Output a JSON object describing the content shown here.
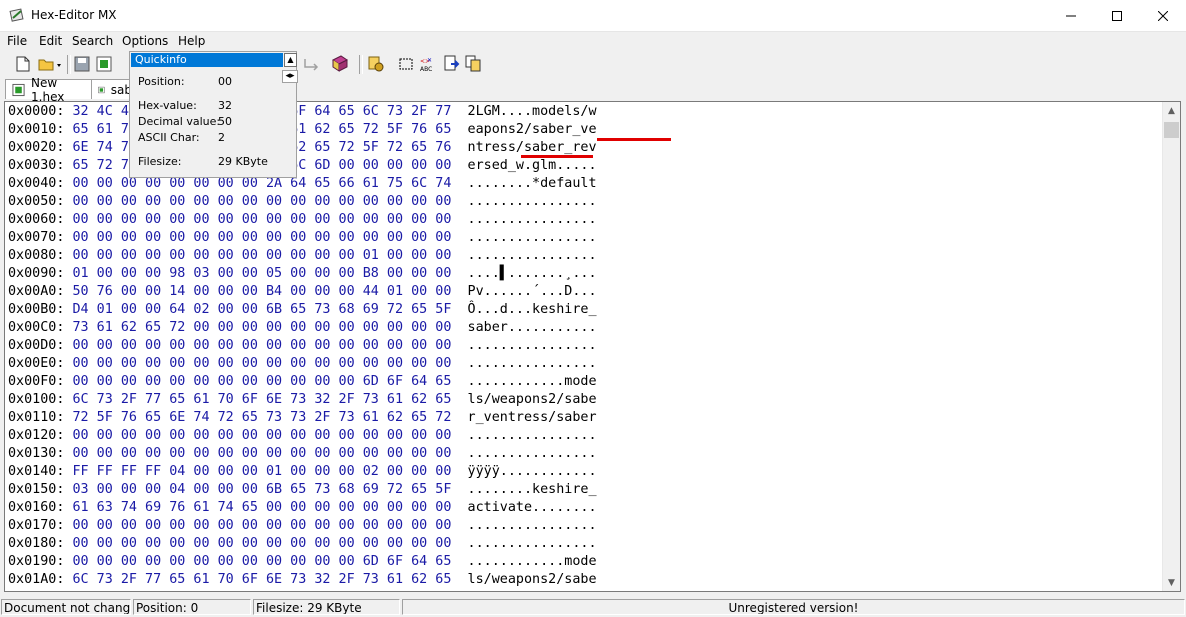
{
  "window": {
    "title": "Hex-Editor MX"
  },
  "menu": [
    "File",
    "Edit",
    "Search",
    "Options",
    "Help"
  ],
  "tabs": [
    {
      "label": "New 1.hex"
    },
    {
      "label": "sab"
    }
  ],
  "quickinfo": {
    "title": "Quickinfo",
    "rows": [
      {
        "label": "Position:",
        "value": "00"
      },
      {
        "label": "Hex-value:",
        "value": "32"
      },
      {
        "label": "Decimal value:",
        "value": "50"
      },
      {
        "label": "ASCII Char:",
        "value": "2"
      },
      {
        "label": "Filesize:",
        "value": "29 KByte"
      }
    ]
  },
  "hex_rows": [
    {
      "addr": "0x0000:",
      "hex": "32 4C 47 4D 06 00 00 00 6D 6F 64 65 6C 73 2F 77",
      "ascii": "2LGM....models/w"
    },
    {
      "addr": "0x0010:",
      "hex": "65 61 70 6F 6E 73 32 2F 73 61 62 65 72 5F 76 65",
      "ascii": "eapons2/saber_ve"
    },
    {
      "addr": "0x0020:",
      "hex": "6E 74 72 65 73 73 2F 73 61 62 65 72 5F 72 65 76",
      "ascii": "ntress/saber_rev"
    },
    {
      "addr": "0x0030:",
      "hex": "65 72 73 65 64 5F 77 2E 67 6C 6D 00 00 00 00 00",
      "ascii": "ersed_w.glm....."
    },
    {
      "addr": "0x0040:",
      "hex": "00 00 00 00 00 00 00 00 2A 64 65 66 61 75 6C 74",
      "ascii": "........*default"
    },
    {
      "addr": "0x0050:",
      "hex": "00 00 00 00 00 00 00 00 00 00 00 00 00 00 00 00",
      "ascii": "................"
    },
    {
      "addr": "0x0060:",
      "hex": "00 00 00 00 00 00 00 00 00 00 00 00 00 00 00 00",
      "ascii": "................"
    },
    {
      "addr": "0x0070:",
      "hex": "00 00 00 00 00 00 00 00 00 00 00 00 00 00 00 00",
      "ascii": "................"
    },
    {
      "addr": "0x0080:",
      "hex": "00 00 00 00 00 00 00 00 00 00 00 00 01 00 00 00",
      "ascii": "................"
    },
    {
      "addr": "0x0090:",
      "hex": "01 00 00 00 98 03 00 00 05 00 00 00 B8 00 00 00",
      "ascii": "....▌.......¸..."
    },
    {
      "addr": "0x00A0:",
      "hex": "50 76 00 00 14 00 00 00 B4 00 00 00 44 01 00 00",
      "ascii": "Pv......´...D..."
    },
    {
      "addr": "0x00B0:",
      "hex": "D4 01 00 00 64 02 00 00 6B 65 73 68 69 72 65 5F",
      "ascii": "Ô...d...keshire_"
    },
    {
      "addr": "0x00C0:",
      "hex": "73 61 62 65 72 00 00 00 00 00 00 00 00 00 00 00",
      "ascii": "saber..........."
    },
    {
      "addr": "0x00D0:",
      "hex": "00 00 00 00 00 00 00 00 00 00 00 00 00 00 00 00",
      "ascii": "................"
    },
    {
      "addr": "0x00E0:",
      "hex": "00 00 00 00 00 00 00 00 00 00 00 00 00 00 00 00",
      "ascii": "................"
    },
    {
      "addr": "0x00F0:",
      "hex": "00 00 00 00 00 00 00 00 00 00 00 00 6D 6F 64 65",
      "ascii": "............mode"
    },
    {
      "addr": "0x0100:",
      "hex": "6C 73 2F 77 65 61 70 6F 6E 73 32 2F 73 61 62 65",
      "ascii": "ls/weapons2/sabe"
    },
    {
      "addr": "0x0110:",
      "hex": "72 5F 76 65 6E 74 72 65 73 73 2F 73 61 62 65 72",
      "ascii": "r_ventress/saber"
    },
    {
      "addr": "0x0120:",
      "hex": "00 00 00 00 00 00 00 00 00 00 00 00 00 00 00 00",
      "ascii": "................"
    },
    {
      "addr": "0x0130:",
      "hex": "00 00 00 00 00 00 00 00 00 00 00 00 00 00 00 00",
      "ascii": "................"
    },
    {
      "addr": "0x0140:",
      "hex": "FF FF FF FF 04 00 00 00 01 00 00 00 02 00 00 00",
      "ascii": "ÿÿÿÿ............"
    },
    {
      "addr": "0x0150:",
      "hex": "03 00 00 00 04 00 00 00 6B 65 73 68 69 72 65 5F",
      "ascii": "........keshire_"
    },
    {
      "addr": "0x0160:",
      "hex": "61 63 74 69 76 61 74 65 00 00 00 00 00 00 00 00",
      "ascii": "activate........"
    },
    {
      "addr": "0x0170:",
      "hex": "00 00 00 00 00 00 00 00 00 00 00 00 00 00 00 00",
      "ascii": "................"
    },
    {
      "addr": "0x0180:",
      "hex": "00 00 00 00 00 00 00 00 00 00 00 00 00 00 00 00",
      "ascii": "................"
    },
    {
      "addr": "0x0190:",
      "hex": "00 00 00 00 00 00 00 00 00 00 00 00 6D 6F 64 65",
      "ascii": "............mode"
    },
    {
      "addr": "0x01A0:",
      "hex": "6C 73 2F 77 65 61 70 6F 6E 73 32 2F 73 61 62 65",
      "ascii": "ls/weapons2/sabe"
    }
  ],
  "status": {
    "changed": "Document not changed",
    "position": "Position: 0",
    "filesize": "Filesize: 29 KByte",
    "registration": "Unregistered version!"
  },
  "colors": {
    "hex_text": "#1a1aa6",
    "annotation": "#e00000",
    "quickinfo_title": "#0078d7"
  }
}
